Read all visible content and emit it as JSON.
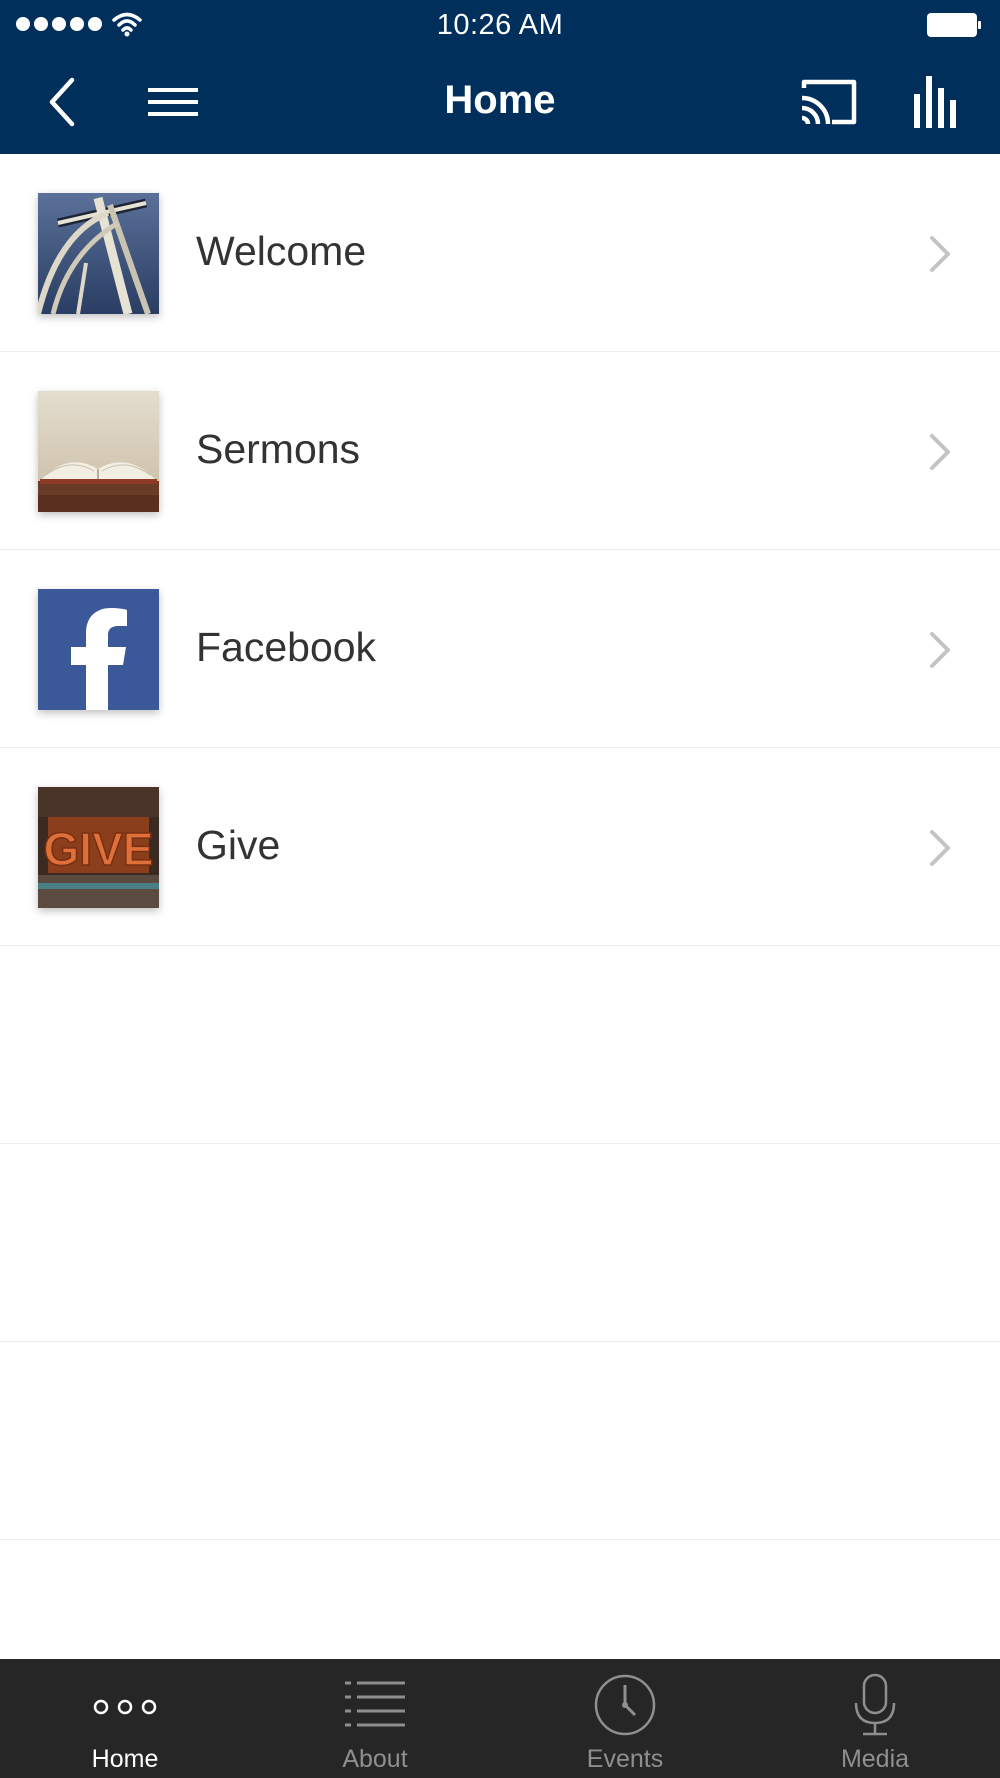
{
  "status_bar": {
    "time": "10:26 AM"
  },
  "nav": {
    "title": "Home"
  },
  "colors": {
    "header": "#002f5c",
    "tabbar": "#262626",
    "tab_active": "#ffffff",
    "tab_inactive": "#8f8f8f"
  },
  "list": {
    "items": [
      {
        "label": "Welcome",
        "icon": "cross-sculpture-thumbnail"
      },
      {
        "label": "Sermons",
        "icon": "open-bible-thumbnail"
      },
      {
        "label": "Facebook",
        "icon": "facebook-logo-thumbnail"
      },
      {
        "label": "Give",
        "icon": "give-letterpress-thumbnail",
        "image_text": "GIVE"
      }
    ]
  },
  "tabs": [
    {
      "label": "Home",
      "icon": "dots-icon",
      "active": true
    },
    {
      "label": "About",
      "icon": "list-icon",
      "active": false
    },
    {
      "label": "Events",
      "icon": "clock-icon",
      "active": false
    },
    {
      "label": "Media",
      "icon": "microphone-icon",
      "active": false
    }
  ]
}
